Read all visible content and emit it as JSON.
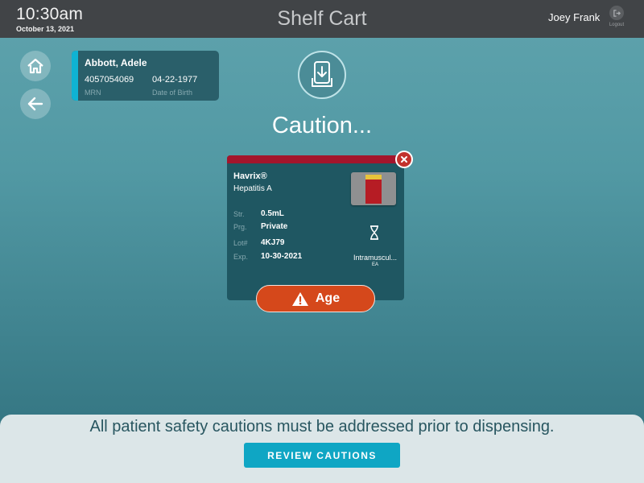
{
  "header": {
    "time": "10:30am",
    "date": "October 13, 2021",
    "title": "Shelf Cart",
    "user": "Joey Frank",
    "logout_label": "Logout"
  },
  "nav": {
    "home_icon": "home-icon",
    "back_icon": "arrow-left-icon"
  },
  "patient": {
    "name": "Abbott, Adele",
    "mrn": "4057054069",
    "mrn_label": "MRN",
    "dob": "04-22-1977",
    "dob_label": "Date of Birth"
  },
  "main": {
    "heading": "Caution..."
  },
  "drug": {
    "name": "Havrix®",
    "description": "Hepatitis A",
    "fields": [
      {
        "label": "Str.",
        "value": "0.5mL"
      },
      {
        "label": "Prg.",
        "value": "Private"
      },
      {
        "label": "Lot#",
        "value": "4KJ79"
      },
      {
        "label": "Exp.",
        "value": "10-30-2021"
      }
    ],
    "route": "Intramuscul...",
    "unit": "EA",
    "caution": "Age"
  },
  "footer": {
    "message": "All patient safety cautions must be addressed prior to dispensing.",
    "review_button": "REVIEW CAUTIONS"
  },
  "colors": {
    "accent": "#0fa6c4",
    "caution": "#d5481b",
    "alert": "#a3152c"
  }
}
